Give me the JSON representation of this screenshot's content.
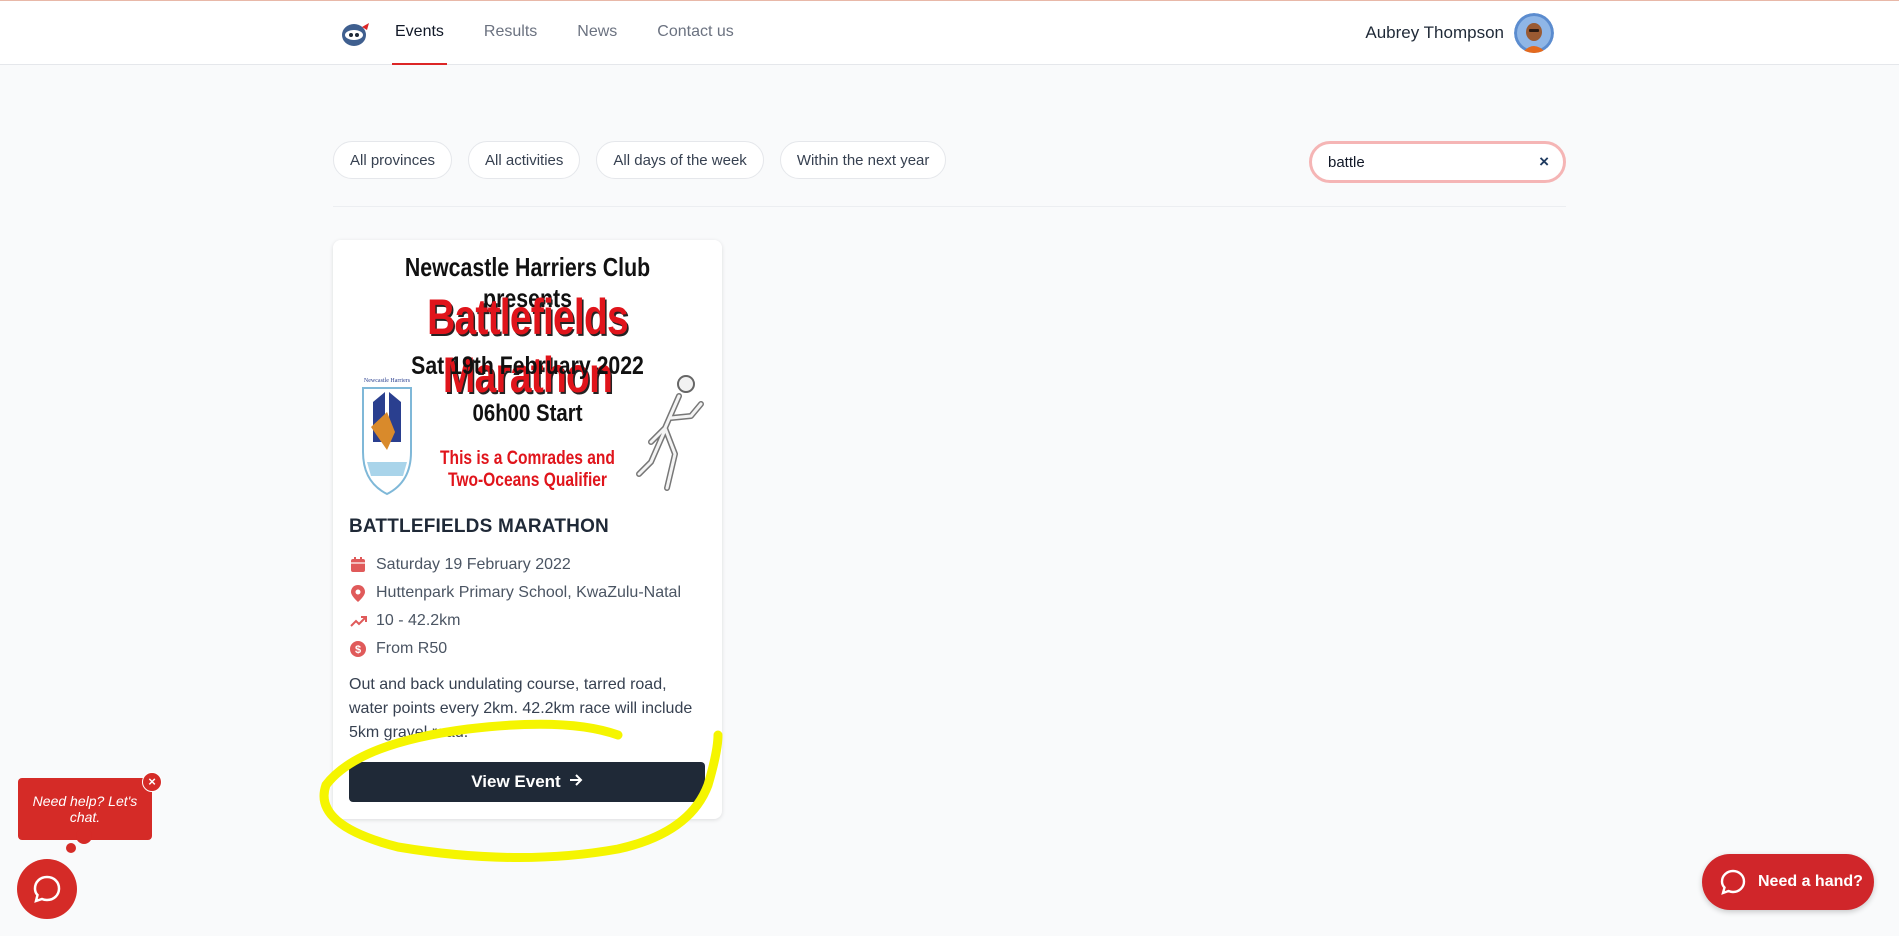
{
  "header": {
    "nav": [
      {
        "label": "Events",
        "active": true
      },
      {
        "label": "Results",
        "active": false
      },
      {
        "label": "News",
        "active": false
      },
      {
        "label": "Contact us",
        "active": false
      }
    ],
    "user_name": "Aubrey Thompson"
  },
  "filters": {
    "province": "All provinces",
    "activity": "All activities",
    "days": "All days of the week",
    "period": "Within the next year"
  },
  "search": {
    "value": "battle",
    "clear_label": "×"
  },
  "event": {
    "poster": {
      "presenter": "Newcastle Harriers Club presents",
      "title": "Battlefields Marathon",
      "date": "Sat 19th February 2022",
      "start": "06h00  Start",
      "qualifier_line1": "This is a Comrades  and",
      "qualifier_line2": "Two-Oceans Qualifier",
      "badge_text": "Newcastle Harriers"
    },
    "name": "BATTLEFIELDS MARATHON",
    "date": "Saturday 19 February 2022",
    "location": "Huttenpark Primary School, KwaZulu-Natal",
    "distance": "10 - 42.2km",
    "price": "From R50",
    "description": "Out and back undulating course, tarred road, water points every 2km. 42.2km race will include 5km gravel road.",
    "button_label": "View Event"
  },
  "chat": {
    "prompt": "Need help? Let's chat.",
    "close_label": "×"
  },
  "help_button_label": "Need a hand?",
  "colors": {
    "accent": "#dc2626",
    "button_dark": "#1f2937",
    "icon_red": "#e05a5a",
    "highlight": "#f5f500"
  }
}
